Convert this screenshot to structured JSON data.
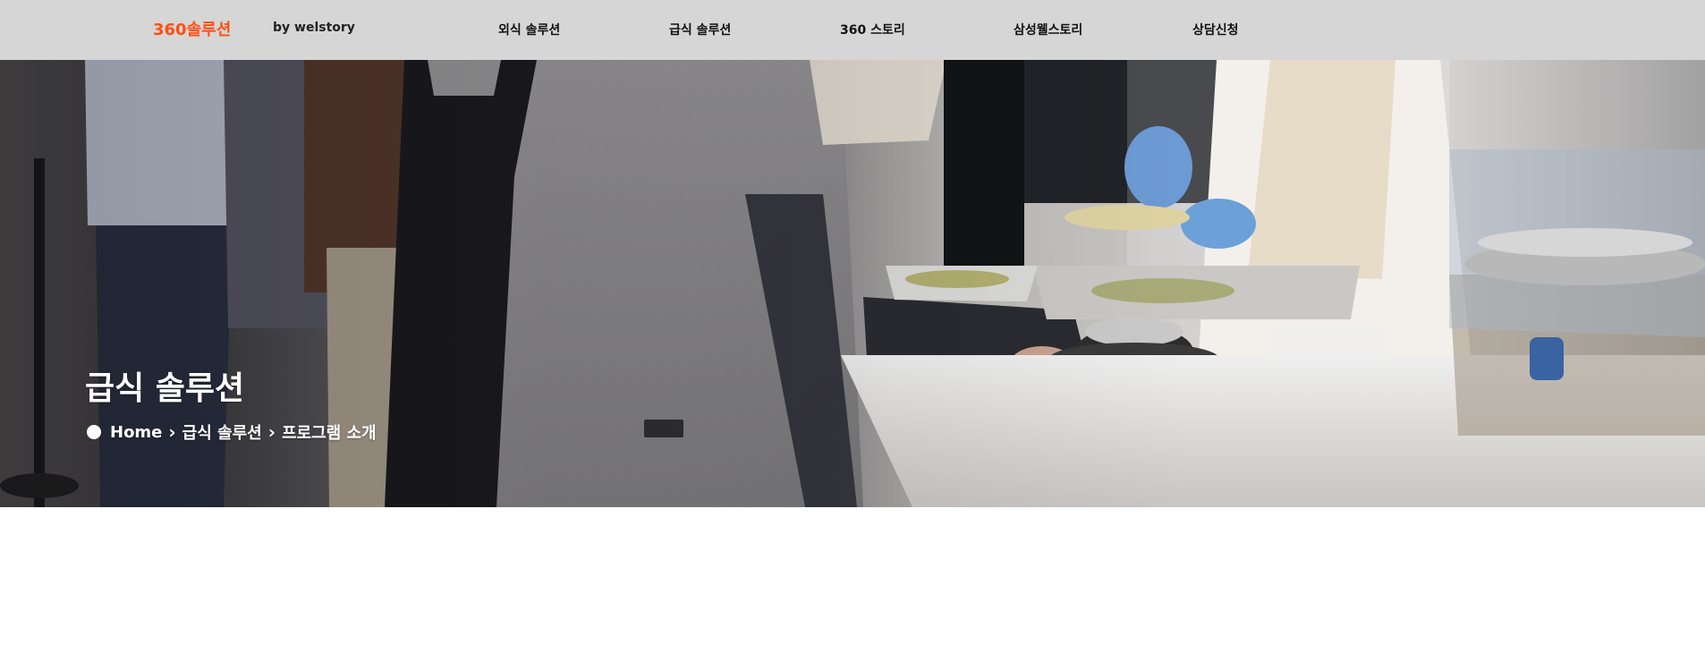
{
  "header": {
    "logo": "360솔루션",
    "byline": "by welstory",
    "nav": [
      {
        "label": "외식 솔루션"
      },
      {
        "label": "급식 솔루션"
      },
      {
        "label": "360 스토리"
      },
      {
        "label": "삼성웰스토리"
      },
      {
        "label": "상담신청"
      }
    ]
  },
  "hero": {
    "title": "급식 솔루션",
    "breadcrumb": {
      "home": "Home",
      "level1": "급식 솔루션",
      "level2": "프로그램 소개"
    }
  },
  "colors": {
    "logo": "#ff4f14",
    "header_bg": "#d6d6d6"
  }
}
